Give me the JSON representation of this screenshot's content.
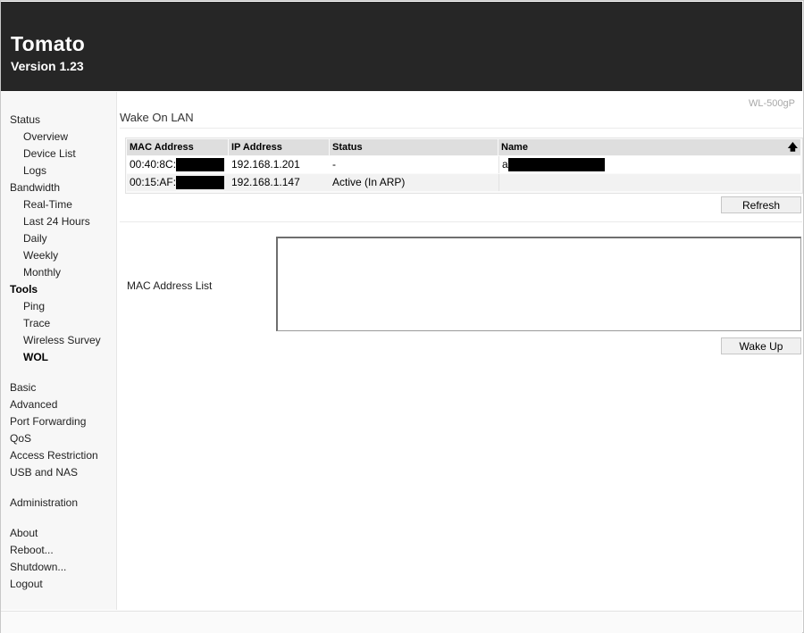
{
  "app": {
    "title": "Tomato",
    "version": "Version 1.23",
    "model": "WL-500gP"
  },
  "sidebar": {
    "items": [
      {
        "label": "Status"
      },
      {
        "label": "Overview"
      },
      {
        "label": "Device List"
      },
      {
        "label": "Logs"
      },
      {
        "label": "Bandwidth"
      },
      {
        "label": "Real-Time"
      },
      {
        "label": "Last 24 Hours"
      },
      {
        "label": "Daily"
      },
      {
        "label": "Weekly"
      },
      {
        "label": "Monthly"
      },
      {
        "label": "Tools"
      },
      {
        "label": "Ping"
      },
      {
        "label": "Trace"
      },
      {
        "label": "Wireless Survey"
      },
      {
        "label": "WOL"
      },
      {
        "label": "Basic"
      },
      {
        "label": "Advanced"
      },
      {
        "label": "Port Forwarding"
      },
      {
        "label": "QoS"
      },
      {
        "label": "Access Restriction"
      },
      {
        "label": "USB and NAS"
      },
      {
        "label": "Administration"
      },
      {
        "label": "About"
      },
      {
        "label": "Reboot..."
      },
      {
        "label": "Shutdown..."
      },
      {
        "label": "Logout"
      }
    ]
  },
  "main": {
    "title": "Wake On LAN",
    "table": {
      "columns": [
        "MAC Address",
        "IP Address",
        "Status",
        "Name"
      ],
      "sort_icon": "up-arrow-icon",
      "rows": [
        {
          "mac": "00:40:8C:",
          "ip": "192.168.1.201",
          "status": "-",
          "name": "a"
        },
        {
          "mac": "00:15:AF:",
          "ip": "192.168.1.147",
          "status": "Active (In ARP)",
          "name": ""
        }
      ]
    },
    "refresh_label": "Refresh",
    "mac_list_label": "MAC Address List",
    "mac_list_value": "",
    "wake_label": "Wake Up"
  },
  "colors": {
    "header_bg": "#262626",
    "sidebar_bg": "#f7f7f7",
    "table_header_bg": "#dedede"
  }
}
